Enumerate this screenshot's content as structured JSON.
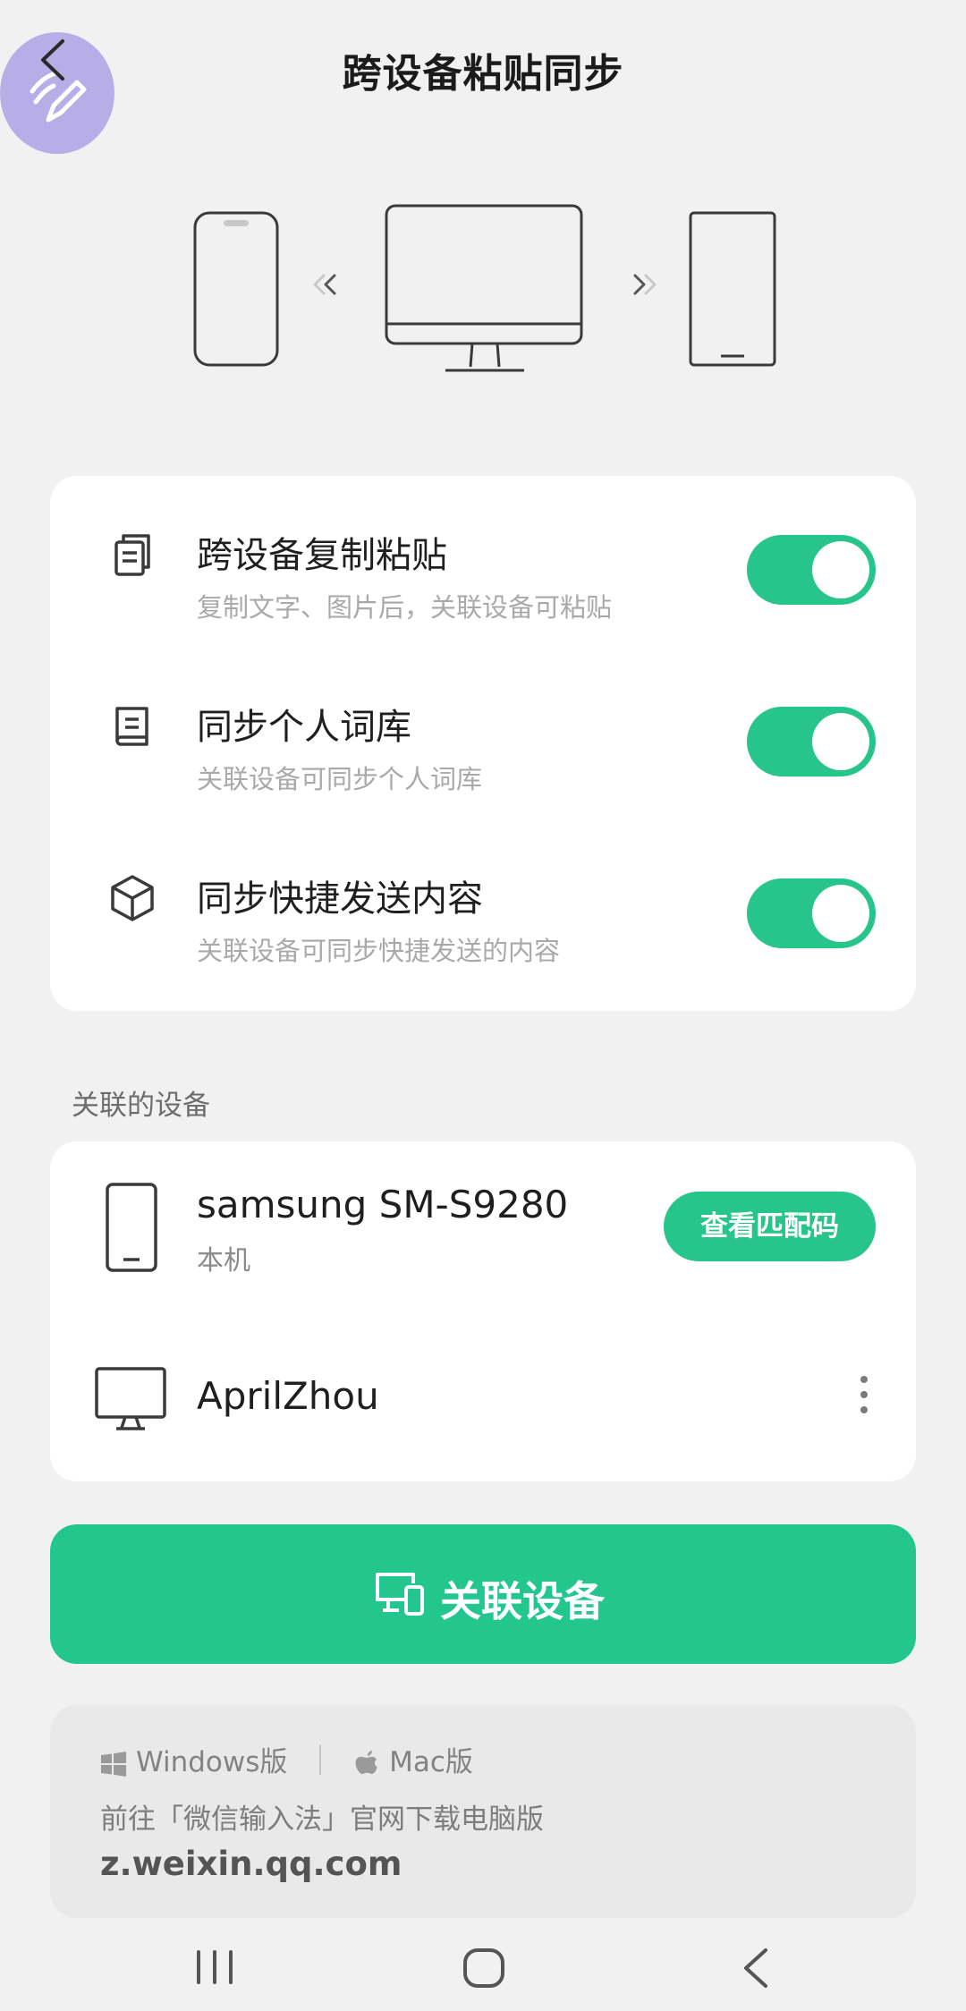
{
  "header": {
    "title": "跨设备粘贴同步",
    "back_icon": "back-arrow-icon",
    "float_icon": "handwriting-pen-icon"
  },
  "illustration": {
    "icons": [
      "phone-icon",
      "arrow-left-icon",
      "monitor-icon",
      "arrow-right-icon",
      "tablet-icon"
    ]
  },
  "settings": [
    {
      "title": "跨设备复制粘贴",
      "subtitle": "复制文字、图片后，关联设备可粘贴",
      "icon": "copy-icon",
      "enabled": true
    },
    {
      "title": "同步个人词库",
      "subtitle": "关联设备可同步个人词库",
      "icon": "book-icon",
      "enabled": true
    },
    {
      "title": "同步快捷发送内容",
      "subtitle": "关联设备可同步快捷发送的内容",
      "icon": "cube-icon",
      "enabled": true
    }
  ],
  "devices_section": {
    "label": "关联的设备"
  },
  "devices": [
    {
      "name": "samsung SM-S9280",
      "subtitle": "本机",
      "icon": "phone-icon",
      "action": "查看匹配码"
    },
    {
      "name": "AprilZhou",
      "icon": "monitor-icon",
      "menu_icon": "more-vertical-icon"
    }
  ],
  "link_button": {
    "label": "关联设备",
    "icon": "devices-icon"
  },
  "download": {
    "windows_label": "Windows版",
    "mac_label": "Mac版",
    "text": "前往「微信输入法」官网下载电脑版",
    "url": "z.weixin.qq.com"
  },
  "navbar": {
    "icons": [
      "recents-icon",
      "home-icon",
      "back-icon"
    ]
  },
  "colors": {
    "accent": "#27c48b",
    "float_button": "#b7aee8",
    "background": "#f1f1f1"
  }
}
